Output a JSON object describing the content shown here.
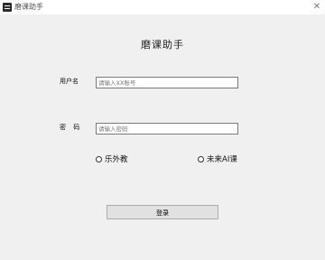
{
  "window": {
    "title": "磨课助手",
    "close_glyph": "✕"
  },
  "heading": "磨课助手",
  "form": {
    "username_label": "用户名",
    "username_placeholder": "请输入XX账号",
    "password_label": "密 码",
    "password_placeholder": "请输入密码",
    "options": [
      "乐外教",
      "未来AI课"
    ],
    "login_label": "登录"
  },
  "icons": {
    "app": "app-icon",
    "close": "close-icon"
  }
}
